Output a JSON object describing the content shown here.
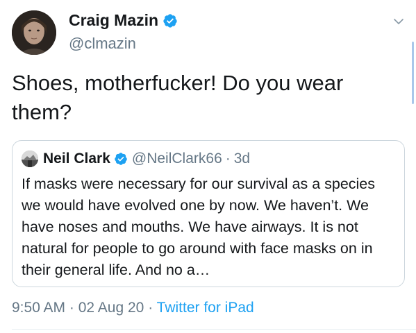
{
  "author": {
    "name": "Craig Mazin",
    "handle": "@clmazin",
    "verified": true
  },
  "tweet": {
    "text": "Shoes, motherfucker! Do you wear them?"
  },
  "quoted": {
    "name": "Neil Clark",
    "handle": "@NeilClark66",
    "separator": "·",
    "time": "3d",
    "verified": true,
    "text": "If masks were necessary for our survival as a species we would have evolved one by now. We haven’t. We have noses and mouths. We have airways. It is not natural for people to go around with face masks on in their general life. And no a…"
  },
  "meta": {
    "time": "9:50 AM",
    "date": "02 Aug 20",
    "separator": "·",
    "source": "Twitter for iPad"
  },
  "icons": {
    "verified": "verified-badge-icon",
    "caret": "chevron-down-icon"
  },
  "colors": {
    "accent": "#1da1f2",
    "secondary_text": "#657786",
    "primary_text": "#14171a",
    "border": "#ccd6dd"
  }
}
